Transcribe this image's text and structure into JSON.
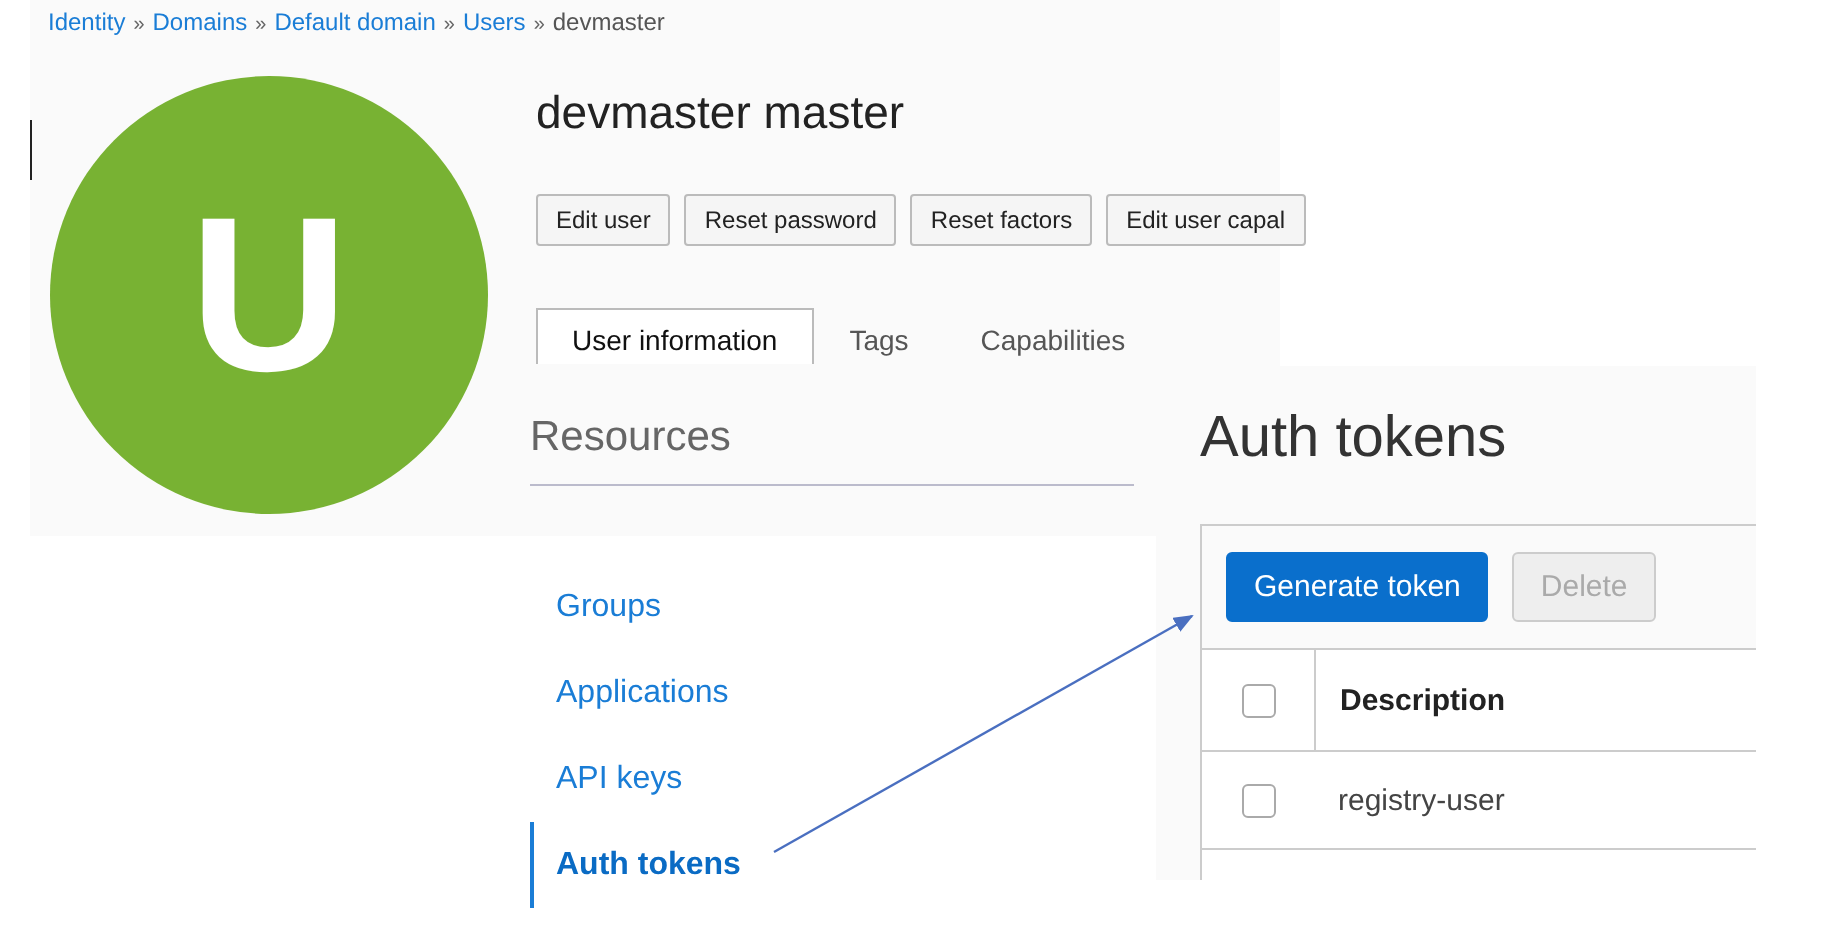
{
  "breadcrumb": [
    {
      "kind": "link",
      "label": "Identity"
    },
    {
      "kind": "separator",
      "label": "»"
    },
    {
      "kind": "link",
      "label": "Domains"
    },
    {
      "kind": "separator",
      "label": "»"
    },
    {
      "kind": "link",
      "label": "Default domain"
    },
    {
      "kind": "separator",
      "label": "»"
    },
    {
      "kind": "link",
      "label": "Users"
    },
    {
      "kind": "separator",
      "label": "»"
    },
    {
      "kind": "current",
      "label": "devmaster"
    }
  ],
  "user": {
    "name": "devmaster master",
    "avatar_letter": "U"
  },
  "actions": [
    {
      "label": "Edit user"
    },
    {
      "label": "Reset password"
    },
    {
      "label": "Reset factors"
    },
    {
      "label": "Edit user capal"
    }
  ],
  "tabs": [
    {
      "label": "User information",
      "selected": true
    },
    {
      "label": "Tags",
      "selected": false
    },
    {
      "label": "Capabilities",
      "selected": false
    }
  ],
  "resources": {
    "title": "Resources",
    "items": [
      {
        "label": "Groups",
        "selected": false
      },
      {
        "label": "Applications",
        "selected": false
      },
      {
        "label": "API keys",
        "selected": false
      },
      {
        "label": "Auth tokens",
        "selected": true
      }
    ]
  },
  "auth_tokens": {
    "title": "Auth tokens",
    "toolbar": [
      {
        "label": "Generate token",
        "kind": "primary",
        "disabled": false
      },
      {
        "label": "Delete",
        "kind": "secondary",
        "disabled": true
      }
    ],
    "header_checked": false,
    "columns": [
      "Description"
    ],
    "rows": [
      {
        "description": "registry-user",
        "checked": false
      }
    ]
  }
}
